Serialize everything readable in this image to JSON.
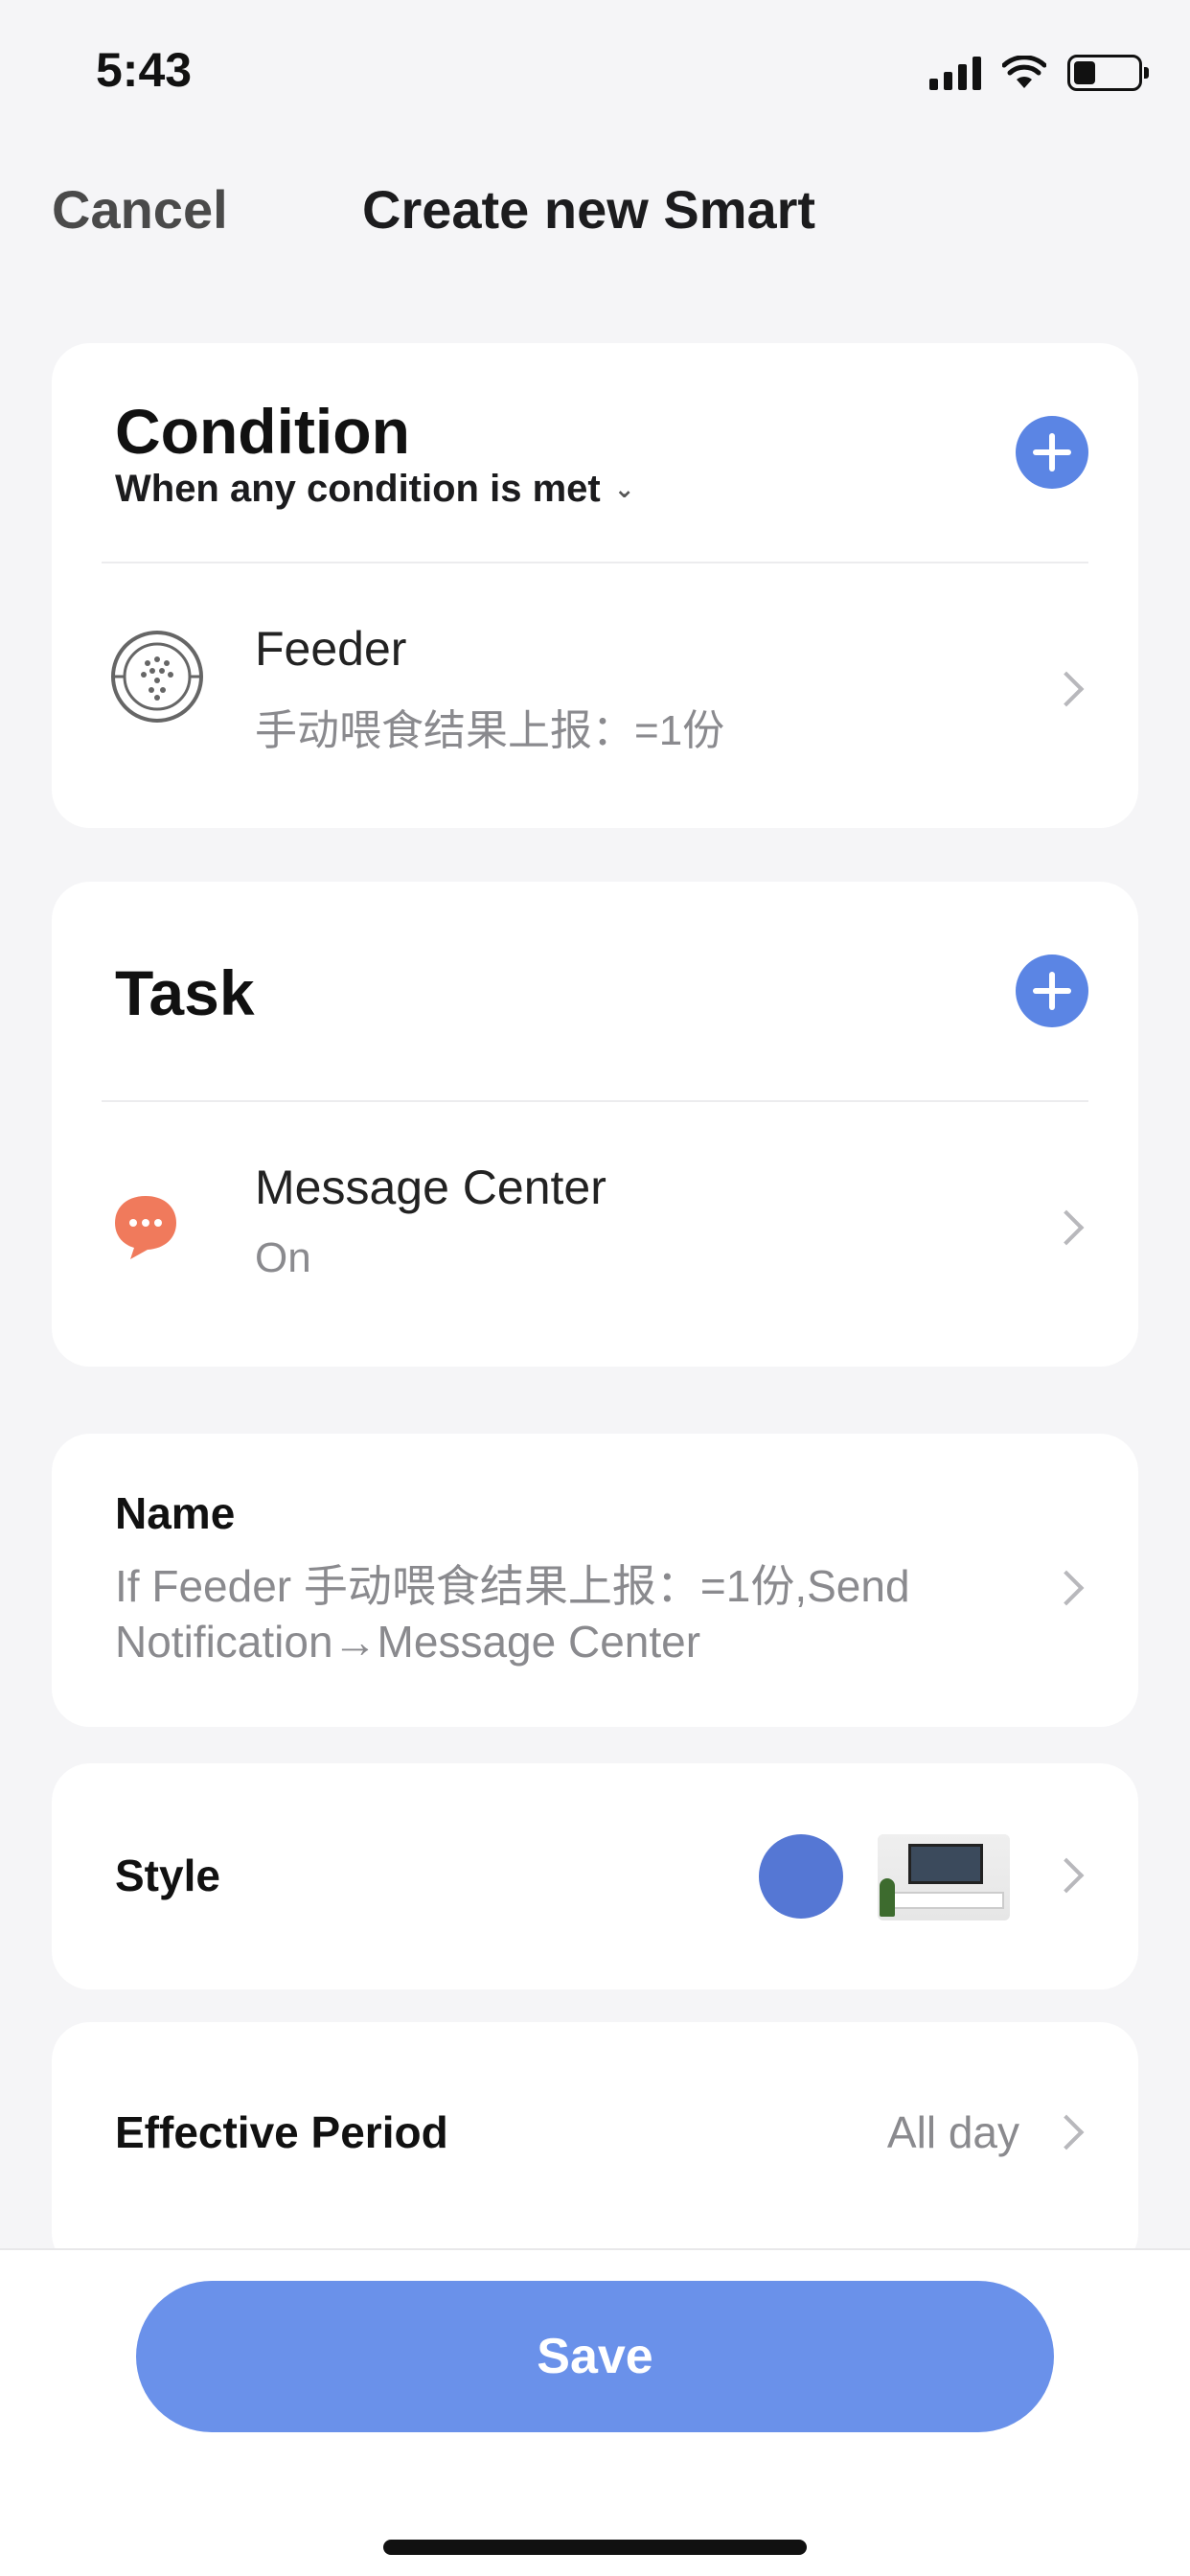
{
  "status_bar": {
    "time": "5:43"
  },
  "nav": {
    "cancel_label": "Cancel",
    "title": "Create new Smart"
  },
  "condition": {
    "title": "Condition",
    "mode": "When any condition is met",
    "items": [
      {
        "title": "Feeder",
        "subtitle": "手动喂食结果上报：=1份",
        "icon": "feeder-icon"
      }
    ]
  },
  "task": {
    "title": "Task",
    "items": [
      {
        "title": "Message Center",
        "subtitle": "On",
        "icon": "message-icon"
      }
    ]
  },
  "name": {
    "label": "Name",
    "value": "If Feeder  手动喂食结果上报：=1份,Send Notification→Message Center"
  },
  "style": {
    "label": "Style",
    "color": "#5577d4",
    "thumbnail": "living-room-thumbnail"
  },
  "effective_period": {
    "label": "Effective Period",
    "value": "All day"
  },
  "footer": {
    "save_label": "Save"
  },
  "colors": {
    "accent": "#5b85e4",
    "save_button": "#6a91ea",
    "message_icon": "#f07a5c"
  }
}
